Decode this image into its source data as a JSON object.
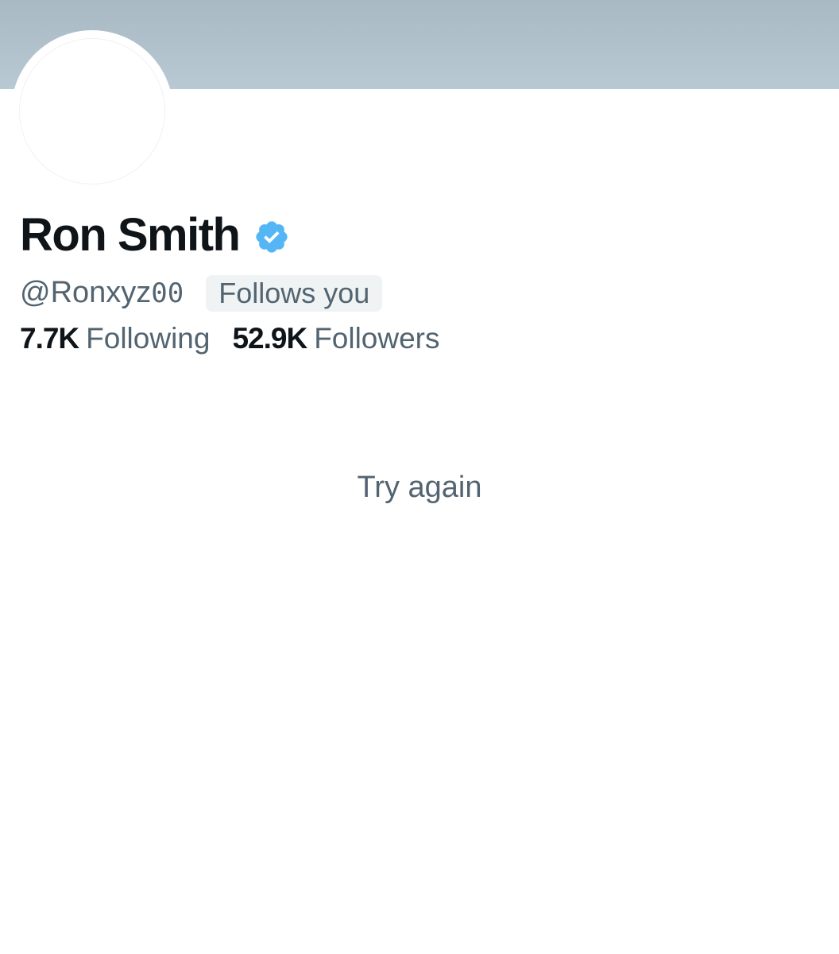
{
  "profile": {
    "display_name": "Ron Smith",
    "handle_prefix": "@Ronxyz",
    "handle_suffix": "00",
    "follows_you_label": "Follows you",
    "verified": true,
    "verified_icon": "verified-badge-icon",
    "stats": {
      "following_count": "7.7K",
      "following_label": "Following",
      "followers_count": "52.9K",
      "followers_label": "Followers"
    }
  },
  "content": {
    "try_again_label": "Try again"
  },
  "colors": {
    "banner": "#b3c3ce",
    "verified_blue": "#1d9bf0",
    "text_primary": "#0f1419",
    "text_secondary": "#536471",
    "badge_bg": "#eff3f4"
  }
}
